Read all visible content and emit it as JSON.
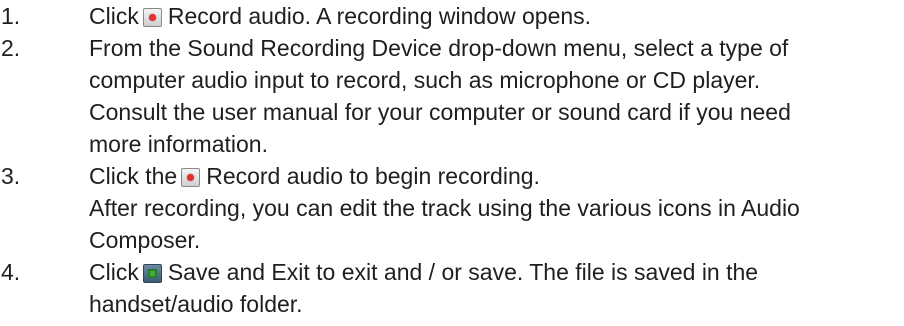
{
  "steps": [
    {
      "number": "1.",
      "before_icon": "Click",
      "icon": "record-icon",
      "after_icon": "Record audio. A recording window opens.",
      "lines": []
    },
    {
      "number": "2.",
      "lines": [
        "From the Sound Recording Device drop-down menu, select a type of",
        "computer audio input to record, such as microphone or CD player.",
        "Consult the user manual for your computer or sound card if you need",
        "more information."
      ]
    },
    {
      "number": "3.",
      "before_icon": "Click the",
      "icon": "record-icon",
      "after_icon": "Record audio to begin recording.",
      "lines": [
        "After recording, you can edit the track using the various icons in Audio",
        "Composer."
      ]
    },
    {
      "number": "4.",
      "before_icon": "Click",
      "icon": "save-exit-icon",
      "after_icon": "Save and Exit to exit and / or save. The file is saved in the",
      "lines": [
        "handset/audio folder."
      ]
    }
  ]
}
